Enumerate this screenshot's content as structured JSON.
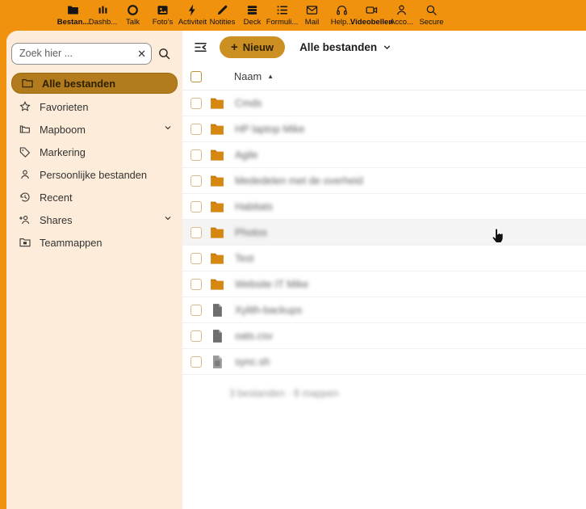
{
  "topbar": {
    "apps": [
      {
        "label": "Bestan...",
        "icon": "files-icon",
        "active": true
      },
      {
        "label": "Dashb...",
        "icon": "dashboard-icon",
        "active": false
      },
      {
        "label": "Talk",
        "icon": "talk-icon",
        "active": false
      },
      {
        "label": "Foto's",
        "icon": "photos-icon",
        "active": false
      },
      {
        "label": "Activiteit",
        "icon": "activity-icon",
        "active": false
      },
      {
        "label": "Notities",
        "icon": "notes-icon",
        "active": false
      },
      {
        "label": "Deck",
        "icon": "deck-icon",
        "active": false
      },
      {
        "label": "Formuli...",
        "icon": "forms-icon",
        "active": false
      },
      {
        "label": "Mail",
        "icon": "mail-icon",
        "active": false
      },
      {
        "label": "Help...",
        "icon": "help-icon",
        "active": false
      },
      {
        "label": "Videobellen",
        "icon": "video-call-icon",
        "active": true
      },
      {
        "label": "Acco...",
        "icon": "account-icon",
        "active": false
      },
      {
        "label": "Secure",
        "icon": "secure-icon",
        "active": false
      }
    ]
  },
  "sidebar": {
    "search_placeholder": "Zoek hier ...",
    "clear_glyph": "✕",
    "items": [
      {
        "label": "Alle bestanden",
        "icon": "folder-icon",
        "selected": true,
        "chevron": false
      },
      {
        "label": "Favorieten",
        "icon": "star-icon",
        "selected": false,
        "chevron": false
      },
      {
        "label": "Mapboom",
        "icon": "folder-tree-icon",
        "selected": false,
        "chevron": true
      },
      {
        "label": "Markering",
        "icon": "tag-icon",
        "selected": false,
        "chevron": false
      },
      {
        "label": "Persoonlijke bestanden",
        "icon": "user-icon",
        "selected": false,
        "chevron": false
      },
      {
        "label": "Recent",
        "icon": "history-icon",
        "selected": false,
        "chevron": false
      },
      {
        "label": "Shares",
        "icon": "share-users-icon",
        "selected": false,
        "chevron": true
      },
      {
        "label": "Teammappen",
        "icon": "team-folder-icon",
        "selected": false,
        "chevron": false
      }
    ]
  },
  "main": {
    "new_button_label": "Nieuw",
    "new_button_plus": "+",
    "view_title": "Alle bestanden",
    "columns": {
      "name": "Naam"
    },
    "sort_ascending_glyph": "▲",
    "rows": [
      {
        "name": "Cmds",
        "type": "folder",
        "redacted": true,
        "hover": false
      },
      {
        "name": "HP laptop Mike",
        "type": "folder",
        "redacted": true,
        "hover": false
      },
      {
        "name": "Agile",
        "type": "folder",
        "redacted": true,
        "hover": false
      },
      {
        "name": "Mededelen met de overheid",
        "type": "folder",
        "redacted": true,
        "hover": false
      },
      {
        "name": "Habitats",
        "type": "folder",
        "redacted": true,
        "hover": false
      },
      {
        "name": "Photos",
        "type": "folder",
        "redacted": true,
        "hover": true
      },
      {
        "name": "Test",
        "type": "folder",
        "redacted": true,
        "hover": false
      },
      {
        "name": "Website IT Mike",
        "type": "folder",
        "redacted": true,
        "hover": false
      },
      {
        "name": "Xylith-backups",
        "type": "file",
        "redacted": true,
        "hover": false
      },
      {
        "name": "oats.csv",
        "type": "file",
        "redacted": true,
        "hover": false
      },
      {
        "name": "sync.sh",
        "type": "file-light",
        "redacted": true,
        "hover": false
      }
    ],
    "summary": "3 bestanden · 8 mappen"
  },
  "colors": {
    "brand_orange": "#f0920e",
    "sidebar_cream": "#fdecd9",
    "selected_pill": "#b27c1e",
    "new_button": "#cb8f22",
    "folder_icon": "#d6870f",
    "file_icon": "#6e6e6e",
    "row_hover": "#f4f4f4"
  }
}
